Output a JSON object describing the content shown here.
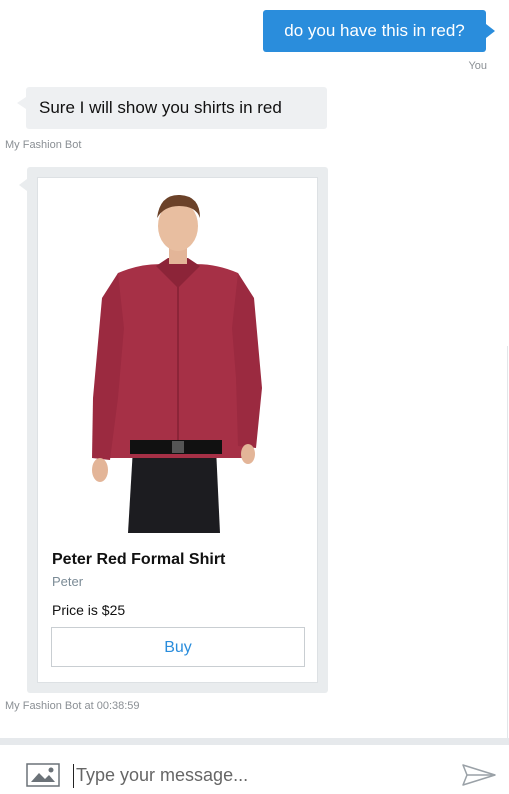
{
  "messages": {
    "user": {
      "text": "do you have this in red?",
      "sender": "You"
    },
    "bot": {
      "text": "Sure I will show you shirts in red",
      "sender": "My Fashion Bot"
    }
  },
  "product_card": {
    "image_icon": "red-shirt-model-photo",
    "title": "Peter Red Formal Shirt",
    "brand": "Peter",
    "price": "Price is $25",
    "button_label": "Buy",
    "timestamp": "My Fashion Bot at 00:38:59"
  },
  "composer": {
    "placeholder": "Type your message...",
    "attach_icon": "image-icon",
    "send_icon": "send-icon"
  },
  "colors": {
    "accent": "#2a8ddc",
    "bubble_bg": "#eef0f2",
    "shirt_red": "#a63046"
  }
}
